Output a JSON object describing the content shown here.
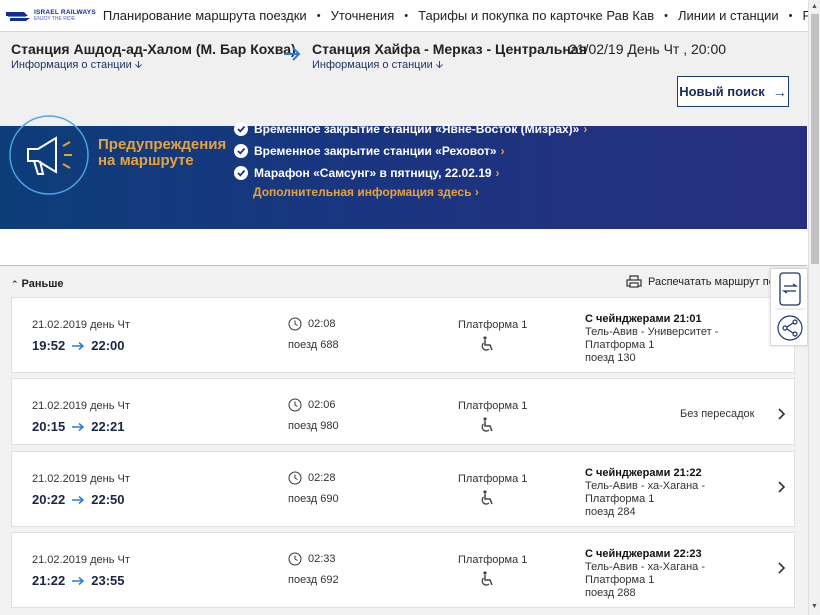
{
  "brand": {
    "logo_line1": "ISRAEL RAILWAYS",
    "logo_line2": "ENJOY THE RIDE"
  },
  "nav": {
    "items": [
      "Планирование маршрута поездки",
      "Уточнения",
      "Тарифы и покупка по карточке Рав Кав",
      "Линии и станции",
      "Рав"
    ]
  },
  "search": {
    "from_name": "Станция Ашдод-ад-Халом (М. Бар Кохва)",
    "from_info": "Информация о станции",
    "to_name": "Станция Хайфа - Мерказ - Центральная",
    "to_info": "Информация о станции",
    "datetime": "21/02/19 День Чт , 20:00",
    "new_search_label": "Новый поиск"
  },
  "alerts": {
    "title_line1": "Предупреждения",
    "title_line2": "на маршруте",
    "items": [
      "Временное закрытие станции «Явне-Восток (Мизрах)»",
      "Временное закрытие станции «Реховот»",
      "Марафон «Самсунг» в пятницу, 22.02.19"
    ],
    "more_info": "Дополнительная информация здесь"
  },
  "results": {
    "earlier_label": "Раньше",
    "print_label": "Распечатать маршрут по",
    "rows": [
      {
        "date": "21.02.2019 день Чт",
        "depart": "19:52",
        "arrive": "22:00",
        "duration": "02:08",
        "train": "поезд 688",
        "platform": "Платформа 1",
        "transfer_title": "С чейнджерами 21:01",
        "transfer_lines": [
          "Тель-Авив - Университет -",
          "Платформа 1",
          "поезд 130"
        ],
        "direct": ""
      },
      {
        "date": "21.02.2019 день Чт",
        "depart": "20:15",
        "arrive": "22:21",
        "duration": "02:06",
        "train": "поезд 980",
        "platform": "Платформа 1",
        "transfer_title": "",
        "transfer_lines": [],
        "direct": "Без пересадок"
      },
      {
        "date": "21.02.2019 день Чт",
        "depart": "20:22",
        "arrive": "22:50",
        "duration": "02:28",
        "train": "поезд 690",
        "platform": "Платформа 1",
        "transfer_title": "С чейнджерами 21:22",
        "transfer_lines": [
          "Тель-Авив - ха-Хагана -",
          "Платформа 1",
          "поезд 284"
        ],
        "direct": ""
      },
      {
        "date": "21.02.2019 день Чт",
        "depart": "21:22",
        "arrive": "23:55",
        "duration": "02:33",
        "train": "поезд 692",
        "platform": "Платформа 1",
        "transfer_title": "С чейнджерами 22:23",
        "transfer_lines": [
          "Тель-Авив - ха-Хагана -",
          "Платформа 1",
          "поезд 288"
        ],
        "direct": ""
      }
    ]
  },
  "colors": {
    "banner_start": "#0d3d79",
    "banner_end": "#272f80",
    "accent_orange": "#e8a23c",
    "dark_navy": "#1c2445",
    "arrow_blue": "#2a7bd4"
  }
}
